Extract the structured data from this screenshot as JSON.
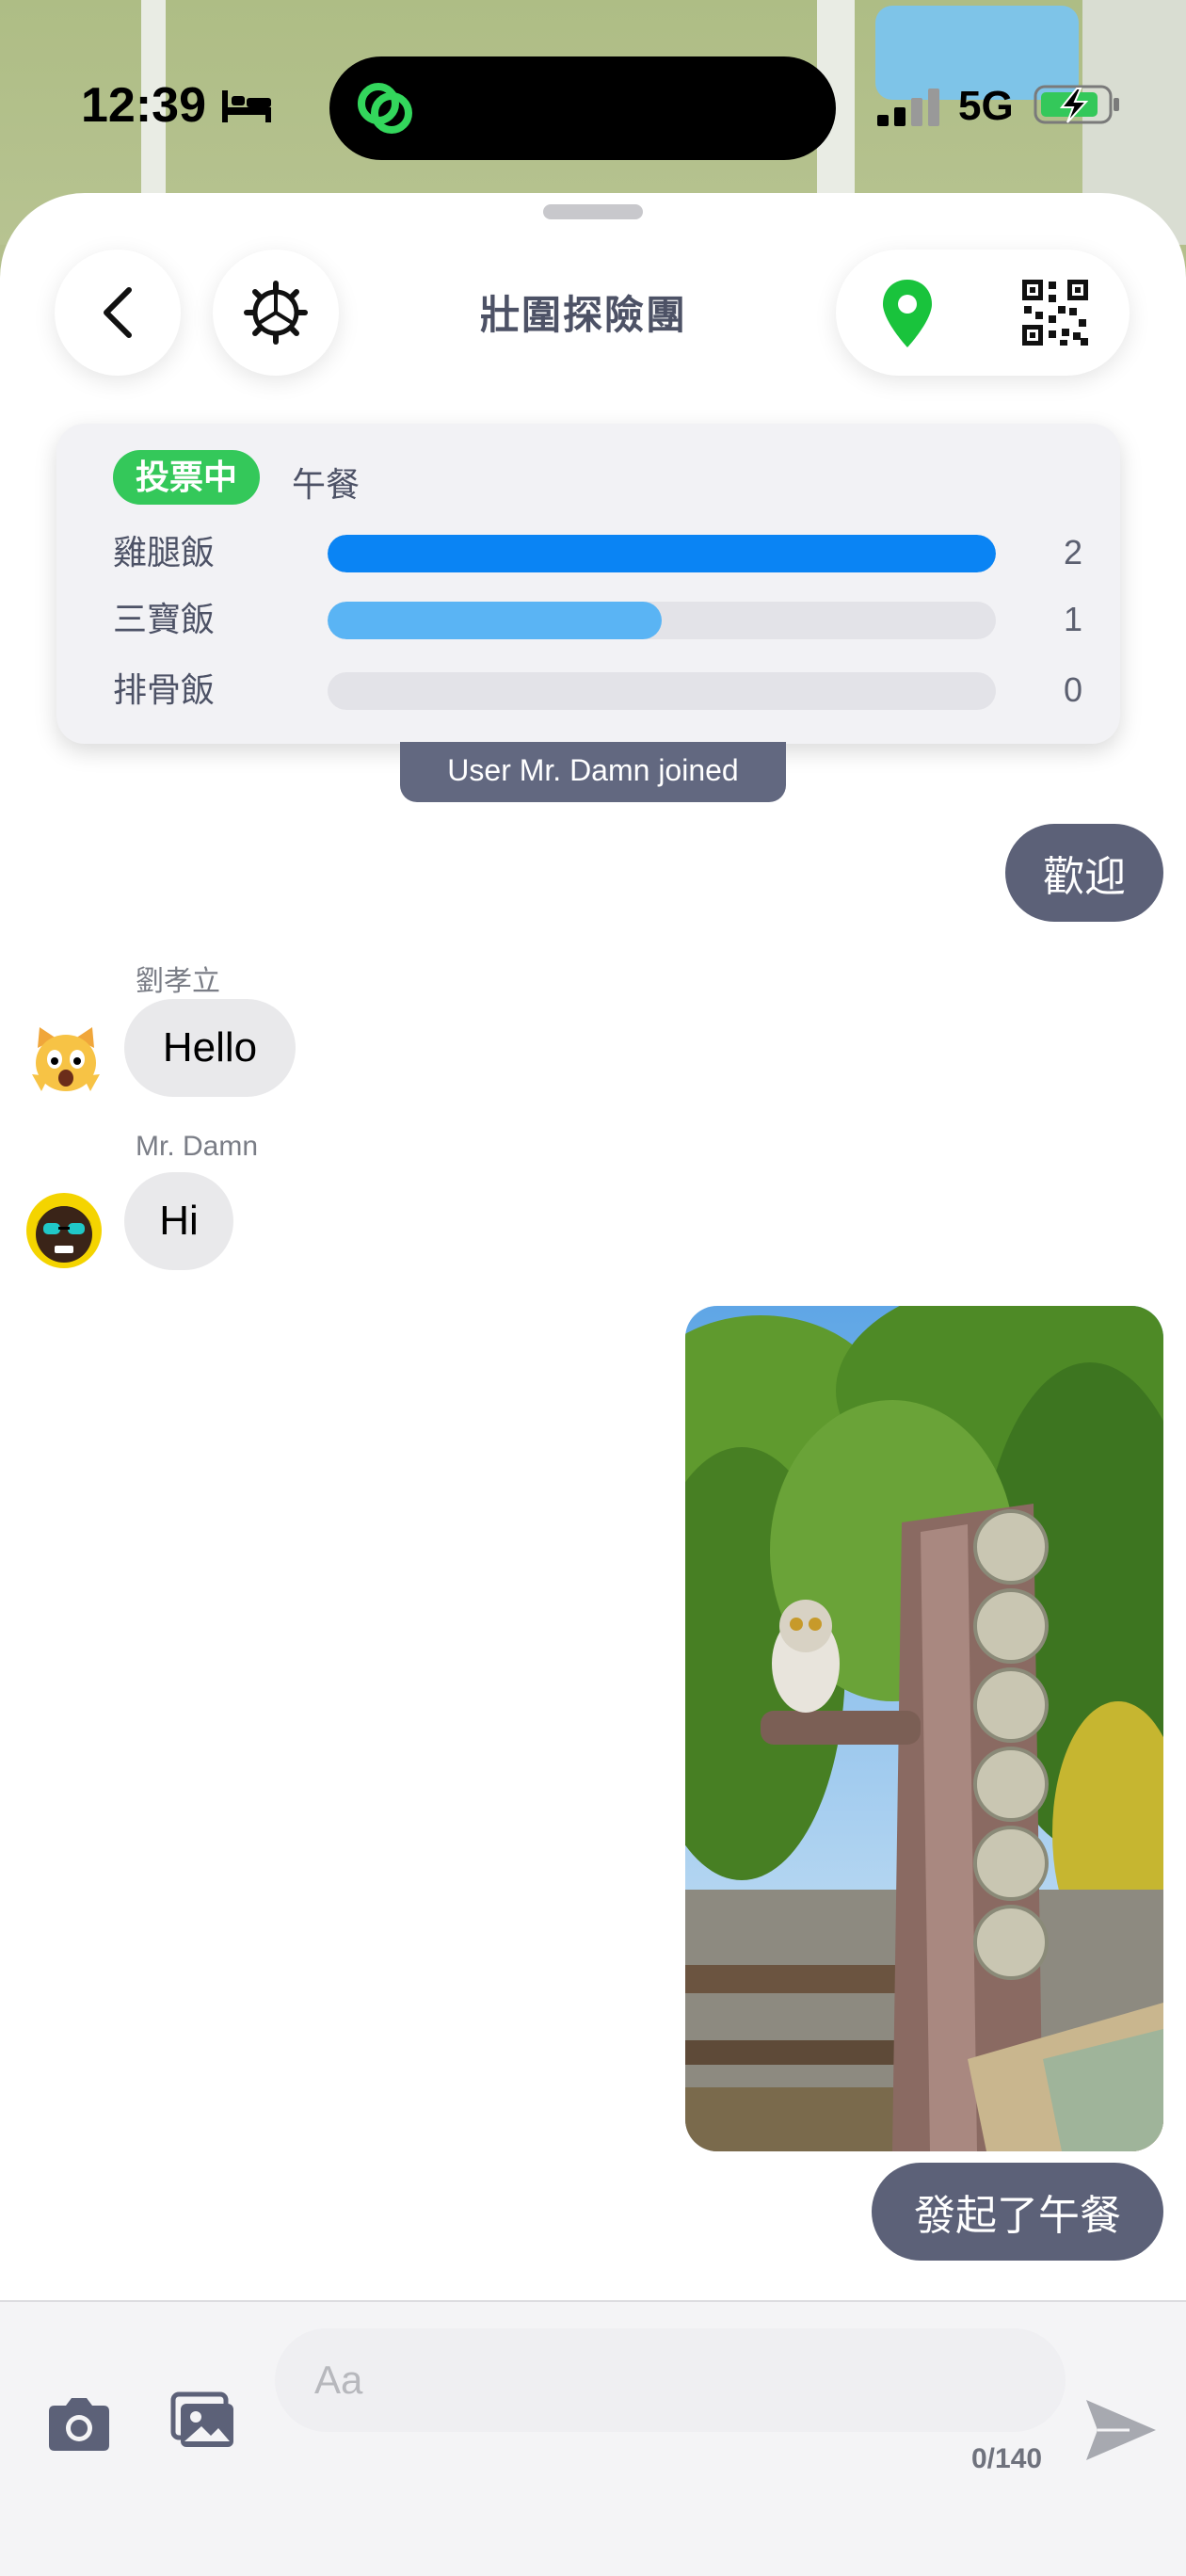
{
  "status_bar": {
    "time": "12:39",
    "network": "5G"
  },
  "header": {
    "title": "壯圍探險團"
  },
  "poll": {
    "badge": "投票中",
    "topic": "午餐",
    "options": [
      {
        "label": "雞腿飯",
        "count": "2",
        "fill": 1.0,
        "color": "#0a84f4"
      },
      {
        "label": "三寶飯",
        "count": "1",
        "fill": 0.5,
        "color": "#5ab4f4"
      },
      {
        "label": "排骨飯",
        "count": "0",
        "fill": 0,
        "color": "#5ab4f4"
      }
    ]
  },
  "messages": {
    "system_join": "User Mr. Damn joined",
    "out_welcome": "歡迎",
    "in_1": {
      "sender": "劉孝立",
      "text": "Hello"
    },
    "in_2": {
      "sender": "Mr. Damn",
      "text": "Hi"
    },
    "out_lunch": "發起了午餐"
  },
  "input": {
    "placeholder": "Aa",
    "char_count": "0/140"
  },
  "icons": {
    "back": "chevron-left-icon",
    "settings": "gear-icon",
    "location": "location-pin-icon",
    "qr": "qr-code-icon",
    "camera": "camera-icon",
    "gallery": "gallery-icon",
    "send": "send-icon"
  },
  "colors": {
    "accent_green": "#34c85a",
    "bubble_out": "#5c6178",
    "bar_primary": "#0a84f4",
    "bar_secondary": "#5ab4f4"
  }
}
